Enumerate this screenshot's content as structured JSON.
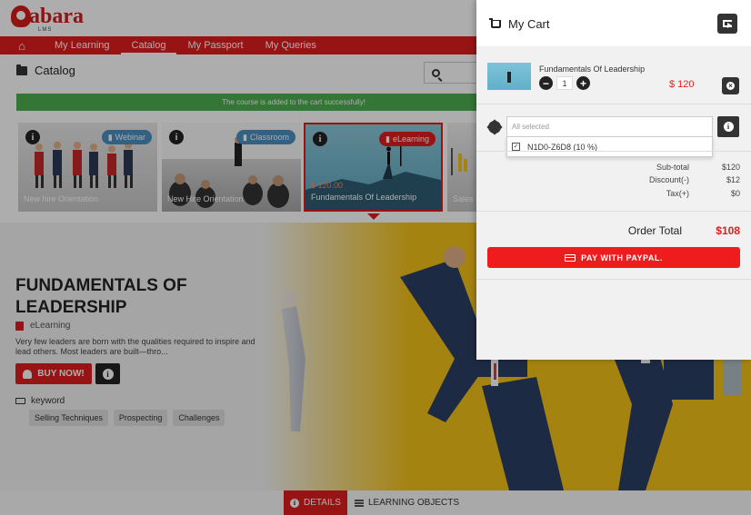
{
  "brand": {
    "logo_text": "abara",
    "logo_sub": "LMS"
  },
  "nav": {
    "items": [
      {
        "label": "My Learning"
      },
      {
        "label": "Catalog"
      },
      {
        "label": "My Passport"
      },
      {
        "label": "My Queries"
      }
    ]
  },
  "catalog": {
    "title": "Catalog"
  },
  "notice": {
    "text": "The course is added to the cart successfully!"
  },
  "cards": [
    {
      "name": "New hire Orientation",
      "type": "Webinar",
      "price": "",
      "badge_color": "#4a90c2"
    },
    {
      "name": "New Hire Orientation",
      "type": "Classroom",
      "price": "",
      "badge_color": "#4a90c2"
    },
    {
      "name": "Fundamentals Of Leadership",
      "type": "eLearning",
      "price": "$ 120.00",
      "badge_color": "#e01e1e"
    },
    {
      "name": "Sales P",
      "type": "",
      "price": "",
      "badge_color": "#4a90c2"
    }
  ],
  "course": {
    "title": "FUNDAMENTALS OF LEADERSHIP",
    "type": "eLearning",
    "description": "Very few leaders are born with the qualities required to inspire and lead others. Most leaders are built—thro...",
    "buy_label": "BUY NOW!",
    "keyword_label": "keyword",
    "keywords": [
      "Selling Techniques",
      "Prospecting",
      "Challenges"
    ]
  },
  "tabs": {
    "details": "DETAILS",
    "learning_objects": "LEARNING OBJECTS"
  },
  "cart": {
    "title": "My Cart",
    "item": {
      "name": "Fundamentals Of Leadership",
      "qty": "1",
      "price": "$ 120"
    },
    "coupon": {
      "placeholder": "All selected",
      "option": "N1D0-Z6D8 (10 %)"
    },
    "summary": [
      {
        "label": "Sub-total",
        "value": "$120"
      },
      {
        "label": "Discount(-)",
        "value": "$12"
      },
      {
        "label": "Tax(+)",
        "value": "$0"
      }
    ],
    "order_total_label": "Order Total",
    "order_total_value": "$108",
    "pay_label": "PAY WITH PAYPAL."
  },
  "colors": {
    "accent": "#e01e1e",
    "success": "#4caf50",
    "hero_bg": "#f4c21a"
  }
}
